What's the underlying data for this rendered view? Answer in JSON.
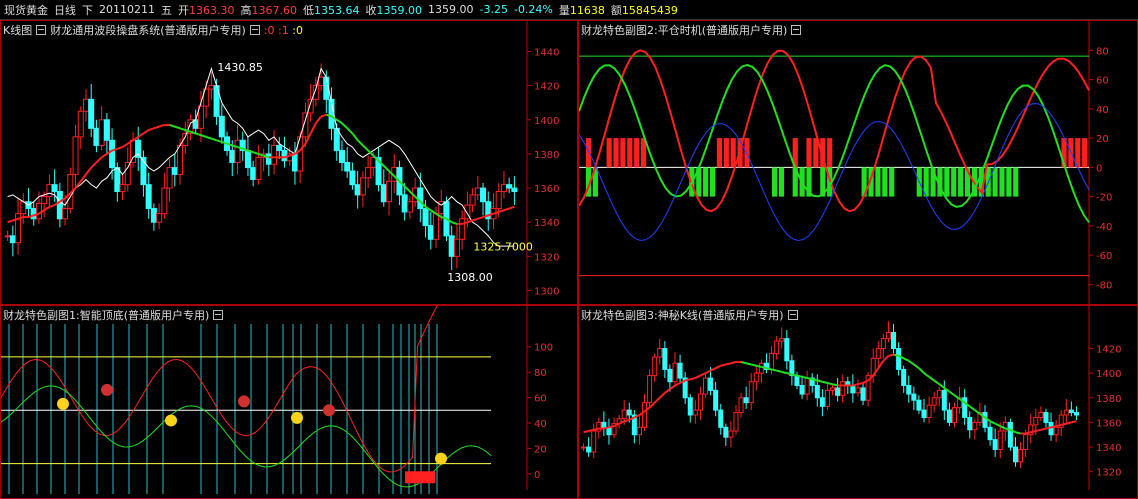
{
  "quote_bar": {
    "name": "现货黄金",
    "period": "日线",
    "suffix": "下",
    "date": "20110211",
    "weekday": "五",
    "open_label": "开",
    "open": "1363.30",
    "high_label": "高",
    "high": "1367.60",
    "low_label": "低",
    "low": "1353.64",
    "close_label": "收",
    "close": "1359.00",
    "prev": "1359.00",
    "change": "-3.25",
    "change_pct": "-0.24%",
    "volume_label": "量",
    "volume": "11638",
    "amount_label": "额",
    "amount": "15845439"
  },
  "panels": {
    "main": {
      "label": "K线图",
      "title": "财龙通用波段操盘系统(普通版用户专用)",
      "flag0": ":0",
      "flag1": ":1",
      "flag2": ":0"
    },
    "sub2": {
      "title": "财龙特色副图2:平仓时机(普通版用户专用)"
    },
    "sub1": {
      "title": "财龙特色副图1:智能顶底(普通版用户专用)"
    },
    "sub3": {
      "title": "财龙特色副图3:神秘K线(普通版用户专用)"
    }
  },
  "colors": {
    "up": "#ff2020",
    "down": "#30ffff",
    "ma": "#20e020",
    "white": "#ffffff",
    "axis": "#c00000",
    "yellow": "#ffff40"
  },
  "chart_data": [
    {
      "type": "candlestick",
      "name": "main",
      "ylim": [
        1295,
        1445
      ],
      "yticks": [
        1300,
        1320,
        1340,
        1360,
        1380,
        1400,
        1420,
        1440
      ],
      "annotations": [
        {
          "text": "1430.85",
          "x": 39,
          "y": 1430.85
        },
        {
          "text": "1308.00",
          "x": 83,
          "y": 1308.0
        },
        {
          "text": "1325.7000",
          "x": 88,
          "y": 1325.7
        }
      ],
      "close": [
        1332,
        1328,
        1345,
        1352,
        1348,
        1342,
        1351,
        1355,
        1362,
        1358,
        1342,
        1348,
        1368,
        1390,
        1405,
        1412,
        1395,
        1385,
        1400,
        1388,
        1372,
        1358,
        1362,
        1375,
        1388,
        1378,
        1362,
        1348,
        1340,
        1345,
        1360,
        1372,
        1368,
        1385,
        1392,
        1400,
        1395,
        1408,
        1418,
        1420,
        1402,
        1390,
        1382,
        1375,
        1388,
        1382,
        1372,
        1365,
        1378,
        1380,
        1374,
        1385,
        1382,
        1376,
        1380,
        1370,
        1390,
        1404,
        1412,
        1420,
        1425,
        1412,
        1395,
        1382,
        1375,
        1370,
        1362,
        1356,
        1366,
        1372,
        1378,
        1362,
        1352,
        1364,
        1372,
        1356,
        1346,
        1352,
        1360,
        1348,
        1338,
        1330,
        1345,
        1352,
        1332,
        1320,
        1330,
        1342,
        1350,
        1356,
        1360,
        1352,
        1342,
        1348,
        1358,
        1362,
        1360,
        1358
      ],
      "ma": [
        1340,
        1341,
        1342,
        1343,
        1343,
        1344,
        1345,
        1347,
        1349,
        1350,
        1352,
        1354,
        1357,
        1360,
        1364,
        1368,
        1372,
        1375,
        1378,
        1380,
        1382,
        1383,
        1384,
        1386,
        1388,
        1390,
        1392,
        1394,
        1395,
        1396,
        1397,
        1397,
        1396,
        1395,
        1394,
        1393,
        1392,
        1391,
        1390,
        1389,
        1388,
        1387,
        1386,
        1385,
        1384,
        1383,
        1382,
        1381,
        1380,
        1379,
        1378,
        1378,
        1378,
        1378,
        1379,
        1380,
        1382,
        1386,
        1392,
        1398,
        1402,
        1403,
        1402,
        1400,
        1398,
        1395,
        1392,
        1388,
        1385,
        1382,
        1379,
        1376,
        1373,
        1370,
        1367,
        1364,
        1361,
        1358,
        1355,
        1352,
        1349,
        1347,
        1345,
        1343,
        1342,
        1340,
        1339,
        1339,
        1340,
        1341,
        1342,
        1343,
        1344,
        1345,
        1346,
        1347,
        1348,
        1349
      ],
      "white": [
        1355,
        1356,
        1354,
        1352,
        1350,
        1352,
        1355,
        1356,
        1357,
        1356,
        1352,
        1350,
        1355,
        1360,
        1362,
        1365,
        1362,
        1360,
        1364,
        1366,
        1370,
        1372,
        1368,
        1372,
        1378,
        1380,
        1376,
        1372,
        1370,
        1372,
        1375,
        1378,
        1380,
        1385,
        1390,
        1398,
        1400,
        1410,
        1420,
        1430,
        1420,
        1410,
        1405,
        1400,
        1398,
        1395,
        1390,
        1392,
        1394,
        1392,
        1388,
        1390,
        1386,
        1384,
        1382,
        1380,
        1390,
        1400,
        1410,
        1418,
        1430,
        1425,
        1410,
        1395,
        1390,
        1386,
        1384,
        1380,
        1378,
        1380,
        1382,
        1384,
        1386,
        1388,
        1386,
        1384,
        1380,
        1375,
        1370,
        1365,
        1360,
        1355,
        1352,
        1350,
        1352,
        1355,
        1352,
        1350,
        1345,
        1340,
        1338,
        1335,
        1332,
        1328,
        1326,
        1326,
        1326,
        1326
      ]
    },
    {
      "type": "oscillator",
      "name": "sub2",
      "ylim": [
        -90,
        85
      ],
      "yticks": [
        80,
        60,
        40,
        20,
        0,
        -20,
        -40,
        -60,
        -80
      ],
      "hlines": [
        {
          "y": 76,
          "color": "#20e020"
        },
        {
          "y": 0,
          "color": "#ffffff"
        },
        {
          "y": -74,
          "color": "#ff2020"
        }
      ],
      "bar_series": [
        0,
        1,
        0,
        0,
        1,
        1,
        1,
        1,
        1,
        1,
        0,
        0,
        0,
        0,
        0,
        0,
        0,
        0,
        0,
        0,
        1,
        1,
        1,
        1,
        1,
        0,
        0,
        0,
        0,
        0,
        0,
        1,
        0,
        1,
        1,
        1,
        1,
        0,
        0,
        0,
        0,
        0,
        0,
        0,
        0,
        0,
        0,
        0,
        0,
        0,
        0,
        0,
        0,
        0,
        0,
        0,
        0,
        0,
        0,
        0,
        0,
        0,
        0,
        0,
        0,
        0,
        0,
        0,
        0,
        0,
        1,
        1,
        1,
        1
      ],
      "green_bars": [
        0,
        -1,
        -1,
        0,
        0,
        0,
        0,
        0,
        0,
        0,
        0,
        0,
        0,
        0,
        0,
        0,
        -1,
        -1,
        -1,
        -1,
        0,
        0,
        0,
        0,
        0,
        0,
        0,
        0,
        -1,
        -1,
        0,
        -1,
        -1,
        -1,
        0,
        -1,
        -1,
        0,
        0,
        0,
        0,
        -1,
        -1,
        -1,
        -1,
        -1,
        0,
        0,
        0,
        -1,
        -1,
        -1,
        -1,
        -1,
        -1,
        -1,
        -1,
        -1,
        -1,
        -1,
        -1,
        -1,
        -1,
        -1,
        0,
        0,
        0,
        0,
        0,
        0,
        0,
        0,
        0,
        0
      ]
    },
    {
      "type": "oscillator",
      "name": "sub1",
      "ylim": [
        -8,
        110
      ],
      "yticks": [
        100,
        80,
        60,
        40,
        20,
        0
      ],
      "hlines": [
        {
          "y": 92,
          "color": "#ffff40"
        },
        {
          "y": 50,
          "color": "#ffffff"
        },
        {
          "y": 8,
          "color": "#ffff40"
        }
      ]
    },
    {
      "type": "candlestick",
      "name": "sub3",
      "ylim": [
        1310,
        1435
      ],
      "yticks": [
        1420,
        1400,
        1380,
        1360,
        1340,
        1320
      ]
    }
  ]
}
